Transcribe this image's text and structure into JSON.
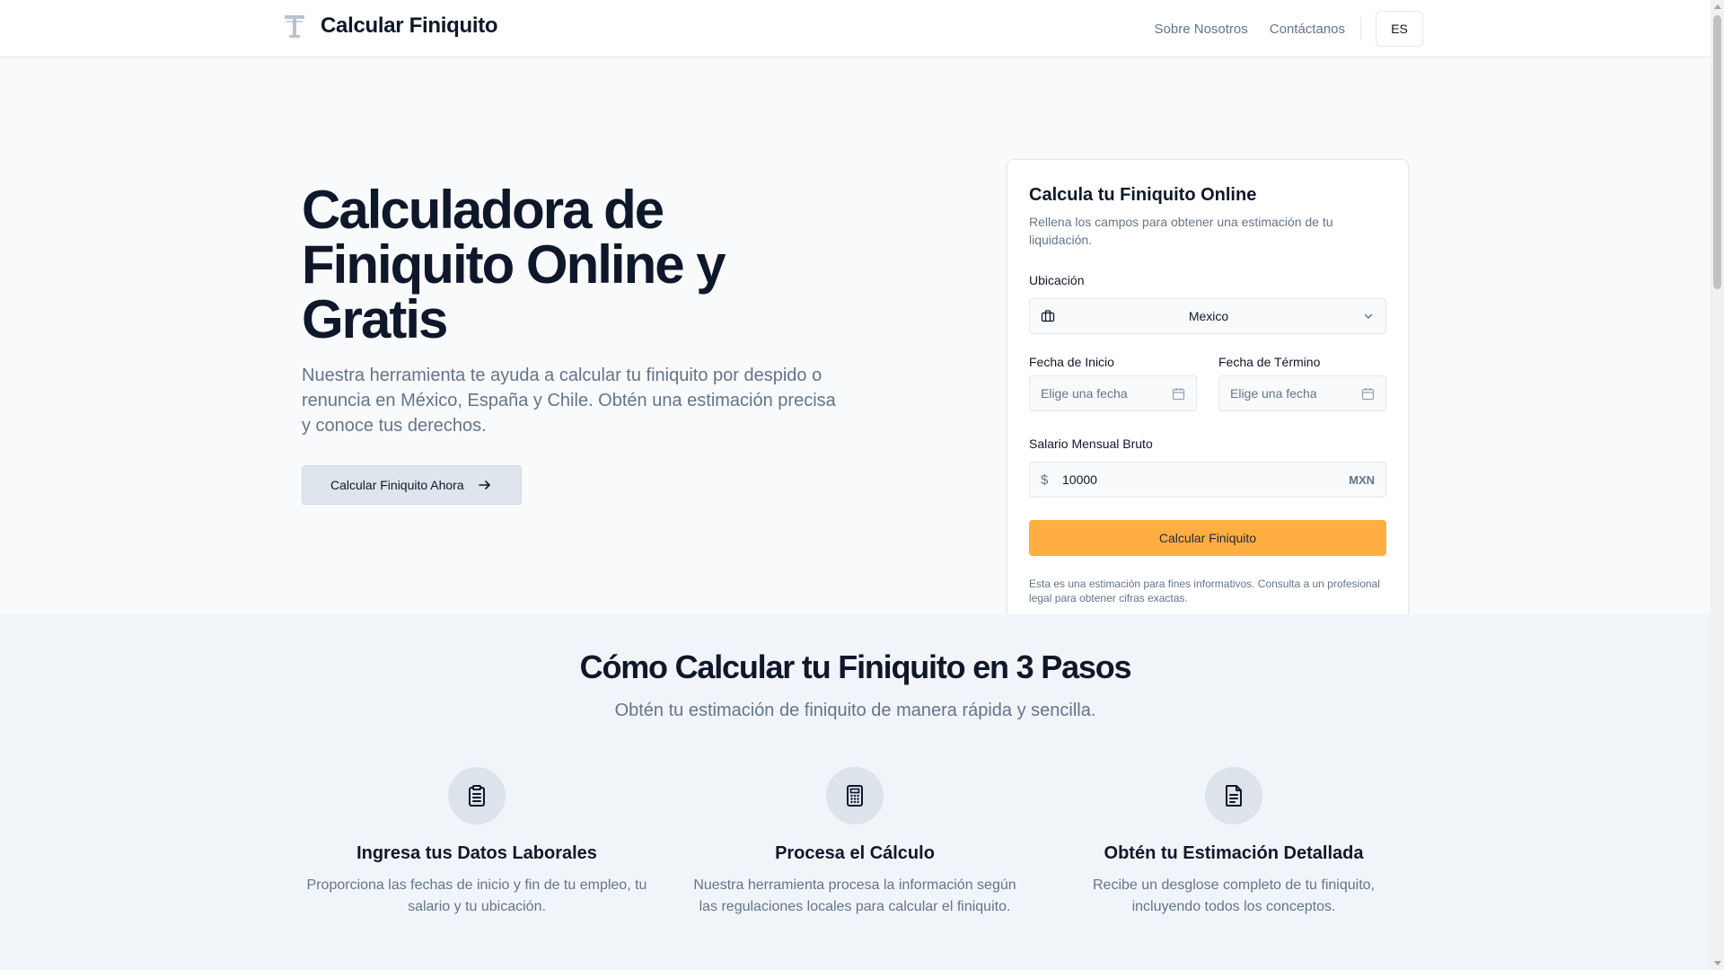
{
  "header": {
    "title": "Calcular Finiquito",
    "nav": [
      "Sobre Nosotros",
      "Contáctanos"
    ],
    "lang": "ES"
  },
  "hero": {
    "title": "Calculadora de Finiquito Online y Gratis",
    "lead": "Nuestra herramienta te ayuda a calcular tu finiquito por despido o renuncia en México, España y Chile. Obtén una estimación precisa y conoce tus derechos.",
    "cta": "Calcular Finiquito Ahora"
  },
  "card": {
    "title": "Calcula tu Finiquito Online",
    "subtitle": "Rellena los campos para obtener una estimación de tu liquidación.",
    "location_label": "Ubicación",
    "location_value": "Mexico",
    "start_label": "Fecha de Inicio",
    "start_placeholder": "Elige una fecha",
    "end_label": "Fecha de Término",
    "end_placeholder": "Elige una fecha",
    "salary_label": "Salario Mensual Bruto",
    "salary_currency_symbol": "$",
    "salary_value": "10000",
    "salary_currency": "MXN",
    "submit": "Calcular Finiquito",
    "disclaimer": "Esta es una estimación para fines informativos. Consulta a un profesional legal para obtener cifras exactas."
  },
  "steps": {
    "title": "Cómo Calcular tu Finiquito en 3 Pasos",
    "subtitle": "Obtén tu estimación de finiquito de manera rápida y sencilla.",
    "items": [
      {
        "icon": "clipboard-list-icon",
        "title": "Ingresa tus Datos Laborales",
        "text": "Proporciona las fechas de inicio y fin de tu empleo, tu salario y tu ubicación."
      },
      {
        "icon": "calculator-icon",
        "title": "Procesa el Cálculo",
        "text": "Nuestra herramienta procesa la información según las regulaciones locales para calcular el finiquito."
      },
      {
        "icon": "file-text-icon",
        "title": "Obtén tu Estimación Detallada",
        "text": "Recibe un desglose completo de tu finiquito, incluyendo todos los conceptos."
      }
    ]
  },
  "colors": {
    "accent": "#ffae42",
    "muted_text": "#64748b",
    "dark_text": "#0f172a"
  }
}
